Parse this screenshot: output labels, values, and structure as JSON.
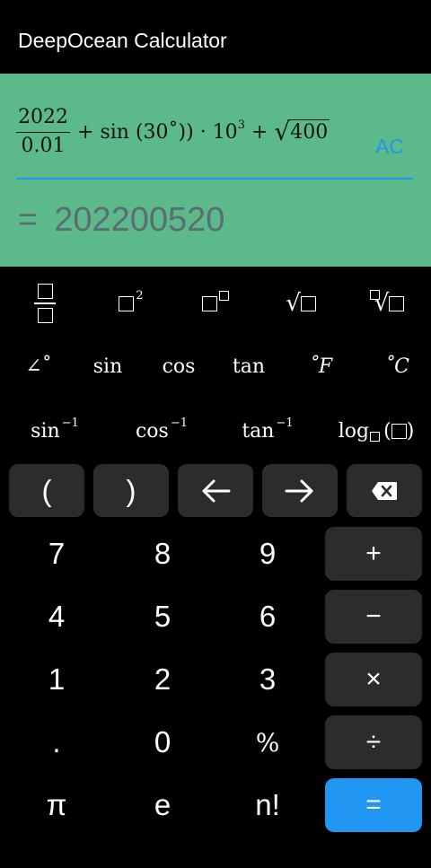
{
  "app": {
    "title": "DeepOcean Calculator"
  },
  "display": {
    "expression": {
      "fraction_numerator": "2022",
      "fraction_denominator": "0.01",
      "op_plus": "+",
      "sin_text": "sin",
      "sin_arg": "(30˚))",
      "mult": "·",
      "power_base": "10",
      "power_exp": "3",
      "op_plus2": "+",
      "sqrt_arg": "400"
    },
    "ac_label": "AC",
    "result_prefix": "=",
    "result_value": "202200520"
  },
  "function_rows": {
    "row1": [
      "fraction",
      "square",
      "power",
      "sqrt",
      "nth-root"
    ],
    "row2": [
      "∠˚",
      "sin",
      "cos",
      "tan",
      "˚F",
      "˚C"
    ],
    "row3": [
      "sin",
      "cos",
      "tan",
      "log"
    ],
    "inverse_sup": "−1",
    "square_sup": "2"
  },
  "nav_keys": {
    "open_paren": "(",
    "close_paren": ")"
  },
  "keys": {
    "digits": [
      "7",
      "8",
      "9",
      "4",
      "5",
      "6",
      "1",
      "2",
      "3",
      ".",
      "0",
      "%",
      "π",
      "e",
      "n!"
    ],
    "operators": [
      "+",
      "−",
      "×",
      "÷",
      "="
    ]
  },
  "colors": {
    "display_bg": "#5cb98a",
    "accent": "#2196f3",
    "key_bg": "#2c2c2c",
    "result_text": "#5b6d74"
  }
}
